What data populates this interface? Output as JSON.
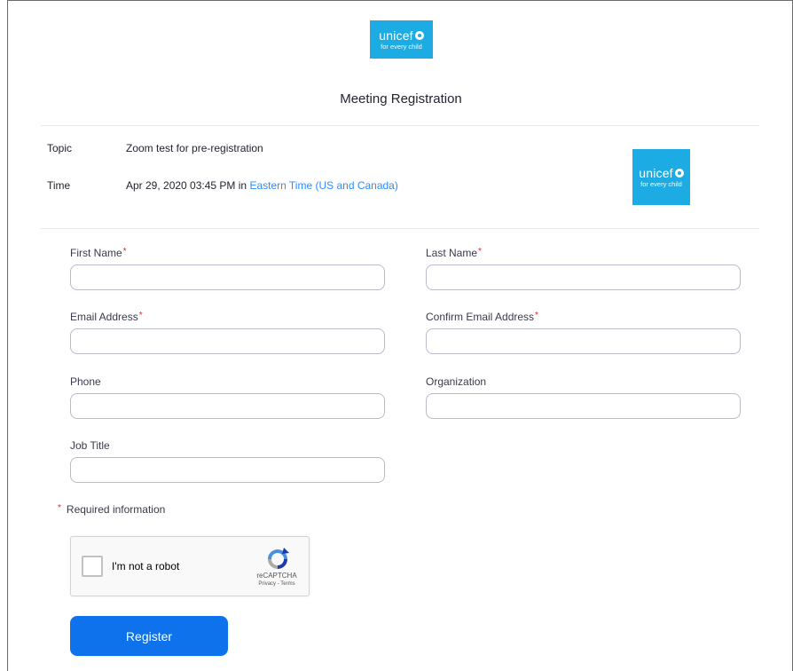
{
  "header": {
    "logo": {
      "brand": "unicef",
      "tagline": "for every child",
      "color": "#1CABE2"
    },
    "title": "Meeting Registration"
  },
  "meeting": {
    "topic_label": "Topic",
    "topic_value": "Zoom test for pre-registration",
    "time_label": "Time",
    "time_value": "Apr 29, 2020 03:45 PM in ",
    "timezone_link": "Eastern Time (US and Canada)",
    "logo": {
      "brand": "unicef",
      "tagline": "for every child"
    }
  },
  "form": {
    "required_marker": "*",
    "fields": {
      "first_name": {
        "label": "First Name",
        "value": ""
      },
      "last_name": {
        "label": "Last Name",
        "value": ""
      },
      "email": {
        "label": "Email Address",
        "value": ""
      },
      "confirm_email": {
        "label": "Confirm Email Address",
        "value": ""
      },
      "phone": {
        "label": "Phone",
        "value": ""
      },
      "organization": {
        "label": "Organization",
        "value": ""
      },
      "job_title": {
        "label": "Job Title",
        "value": ""
      }
    },
    "required_note": "Required information"
  },
  "captcha": {
    "label": "I'm not a robot",
    "brand": "reCAPTCHA",
    "links": "Privacy - Terms"
  },
  "actions": {
    "register_label": "Register",
    "accent_color": "#0E72ED",
    "link_color": "#2D8CFF"
  }
}
